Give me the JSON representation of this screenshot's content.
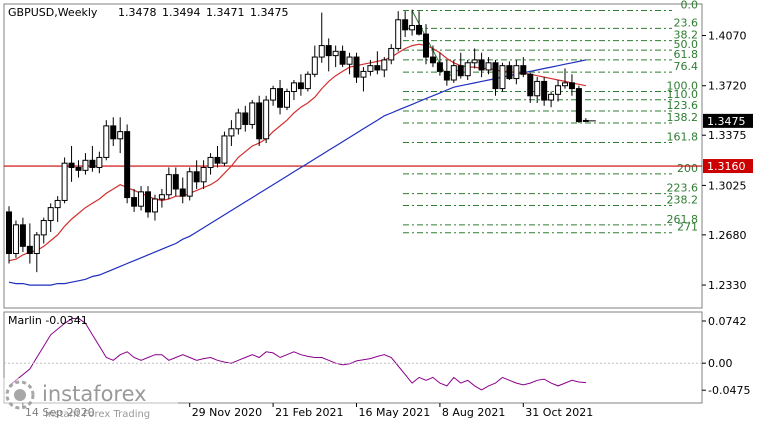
{
  "chart_data": [
    {
      "type": "candlestick",
      "symbol": "GBPUSD,Weekly",
      "ohlc_header": [
        "1.3478",
        "1.3494",
        "1.3471",
        "1.3475"
      ],
      "ylim": [
        1.217,
        1.429
      ],
      "y_ticks": [
        "1.4070",
        "1.3720",
        "1.3375",
        "1.3025",
        "1.2680",
        "1.2330"
      ],
      "current_price": {
        "label": "1.3475",
        "value": 1.3475
      },
      "horizontal_line": {
        "label": "1.3160",
        "value": 1.316,
        "color": "#cc0000"
      },
      "x_labels": [
        "14 Sep 2020",
        "29 Nov 2020",
        "21 Feb 2021",
        "16 May 2021",
        "8 Aug 2021",
        "31 Oct 2021"
      ],
      "fib_levels": [
        {
          "label": "0.0",
          "value": 1.4245
        },
        {
          "label": "23.6",
          "value": 1.412
        },
        {
          "label": "38.2",
          "value": 1.4035
        },
        {
          "label": "50.0",
          "value": 1.3968
        },
        {
          "label": "61.8",
          "value": 1.39
        },
        {
          "label": "76.4",
          "value": 1.3815
        },
        {
          "label": "100.0",
          "value": 1.368
        },
        {
          "label": "110.0",
          "value": 1.3622
        },
        {
          "label": "123.6",
          "value": 1.3544
        },
        {
          "label": "138.2",
          "value": 1.346
        },
        {
          "label": "161.8",
          "value": 1.3324
        },
        {
          "label": "200",
          "value": 1.3105
        },
        {
          "label": "223.6",
          "value": 1.2968
        },
        {
          "label": "238.2",
          "value": 1.2885
        },
        {
          "label": "261.8",
          "value": 1.275
        },
        {
          "label": "271",
          "value": 1.2695
        }
      ],
      "candles": [
        [
          1.284,
          1.288,
          1.248,
          1.255
        ],
        [
          1.255,
          1.278,
          1.252,
          1.275
        ],
        [
          1.275,
          1.28,
          1.256,
          1.26
        ],
        [
          1.26,
          1.276,
          1.248,
          1.255
        ],
        [
          1.255,
          1.27,
          1.242,
          1.268
        ],
        [
          1.268,
          1.28,
          1.262,
          1.278
        ],
        [
          1.278,
          1.29,
          1.27,
          1.287
        ],
        [
          1.287,
          1.295,
          1.277,
          1.292
        ],
        [
          1.292,
          1.322,
          1.29,
          1.318
        ],
        [
          1.318,
          1.33,
          1.305,
          1.315
        ],
        [
          1.315,
          1.32,
          1.308,
          1.313
        ],
        [
          1.313,
          1.325,
          1.31,
          1.32
        ],
        [
          1.32,
          1.33,
          1.312,
          1.315
        ],
        [
          1.315,
          1.326,
          1.311,
          1.322
        ],
        [
          1.322,
          1.348,
          1.32,
          1.344
        ],
        [
          1.344,
          1.35,
          1.33,
          1.335
        ],
        [
          1.335,
          1.35,
          1.325,
          1.34
        ],
        [
          1.34,
          1.345,
          1.29,
          1.294
        ],
        [
          1.294,
          1.3,
          1.284,
          1.288
        ],
        [
          1.288,
          1.302,
          1.285,
          1.298
        ],
        [
          1.298,
          1.302,
          1.28,
          1.284
        ],
        [
          1.284,
          1.296,
          1.278,
          1.293
        ],
        [
          1.293,
          1.3,
          1.287,
          1.296
        ],
        [
          1.296,
          1.315,
          1.293,
          1.31
        ],
        [
          1.31,
          1.315,
          1.295,
          1.3
        ],
        [
          1.3,
          1.308,
          1.29,
          1.295
        ],
        [
          1.295,
          1.315,
          1.292,
          1.312
        ],
        [
          1.312,
          1.32,
          1.3,
          1.305
        ],
        [
          1.305,
          1.32,
          1.3,
          1.315
        ],
        [
          1.315,
          1.325,
          1.31,
          1.322
        ],
        [
          1.322,
          1.33,
          1.315,
          1.318
        ],
        [
          1.318,
          1.34,
          1.316,
          1.337
        ],
        [
          1.337,
          1.348,
          1.33,
          1.342
        ],
        [
          1.342,
          1.356,
          1.338,
          1.353
        ],
        [
          1.353,
          1.358,
          1.34,
          1.345
        ],
        [
          1.345,
          1.362,
          1.342,
          1.36
        ],
        [
          1.36,
          1.365,
          1.33,
          1.335
        ],
        [
          1.335,
          1.365,
          1.332,
          1.362
        ],
        [
          1.362,
          1.372,
          1.358,
          1.37
        ],
        [
          1.37,
          1.376,
          1.352,
          1.357
        ],
        [
          1.357,
          1.37,
          1.355,
          1.368
        ],
        [
          1.368,
          1.376,
          1.362,
          1.374
        ],
        [
          1.374,
          1.38,
          1.365,
          1.37
        ],
        [
          1.37,
          1.382,
          1.368,
          1.38
        ],
        [
          1.38,
          1.4,
          1.378,
          1.392
        ],
        [
          1.392,
          1.423,
          1.388,
          1.4
        ],
        [
          1.4,
          1.405,
          1.382,
          1.393
        ],
        [
          1.393,
          1.4,
          1.385,
          1.396
        ],
        [
          1.396,
          1.4,
          1.385,
          1.387
        ],
        [
          1.387,
          1.395,
          1.38,
          1.392
        ],
        [
          1.392,
          1.395,
          1.374,
          1.378
        ],
        [
          1.378,
          1.385,
          1.368,
          1.382
        ],
        [
          1.382,
          1.39,
          1.379,
          1.386
        ],
        [
          1.386,
          1.396,
          1.38,
          1.383
        ],
        [
          1.383,
          1.392,
          1.378,
          1.39
        ],
        [
          1.39,
          1.401,
          1.387,
          1.398
        ],
        [
          1.398,
          1.424,
          1.396,
          1.418
        ],
        [
          1.418,
          1.424,
          1.406,
          1.411
        ],
        [
          1.411,
          1.425,
          1.407,
          1.414
        ],
        [
          1.414,
          1.424,
          1.407,
          1.408
        ],
        [
          1.408,
          1.415,
          1.387,
          1.392
        ],
        [
          1.392,
          1.4,
          1.385,
          1.388
        ],
        [
          1.388,
          1.395,
          1.379,
          1.382
        ],
        [
          1.382,
          1.39,
          1.372,
          1.376
        ],
        [
          1.376,
          1.39,
          1.374,
          1.386
        ],
        [
          1.386,
          1.395,
          1.377,
          1.379
        ],
        [
          1.379,
          1.39,
          1.376,
          1.388
        ],
        [
          1.388,
          1.398,
          1.384,
          1.39
        ],
        [
          1.39,
          1.395,
          1.378,
          1.383
        ],
        [
          1.383,
          1.392,
          1.38,
          1.388
        ],
        [
          1.388,
          1.39,
          1.365,
          1.37
        ],
        [
          1.37,
          1.388,
          1.368,
          1.386
        ],
        [
          1.386,
          1.389,
          1.376,
          1.377
        ],
        [
          1.377,
          1.39,
          1.373,
          1.386
        ],
        [
          1.386,
          1.392,
          1.378,
          1.38
        ],
        [
          1.38,
          1.381,
          1.36,
          1.365
        ],
        [
          1.365,
          1.378,
          1.36,
          1.375
        ],
        [
          1.375,
          1.378,
          1.358,
          1.362
        ],
        [
          1.362,
          1.368,
          1.357,
          1.366
        ],
        [
          1.366,
          1.376,
          1.361,
          1.372
        ],
        [
          1.372,
          1.384,
          1.37,
          1.374
        ],
        [
          1.374,
          1.38,
          1.365,
          1.37
        ],
        [
          1.37,
          1.372,
          1.346,
          1.347
        ],
        [
          1.3478,
          1.3494,
          1.3471,
          1.3475
        ]
      ],
      "ma_red": [
        1.25,
        1.251,
        1.254,
        1.256,
        1.257,
        1.26,
        1.264,
        1.268,
        1.274,
        1.279,
        1.283,
        1.287,
        1.29,
        1.293,
        1.297,
        1.3,
        1.303,
        1.301,
        1.299,
        1.297,
        1.295,
        1.293,
        1.292,
        1.293,
        1.295,
        1.295,
        1.297,
        1.299,
        1.301,
        1.303,
        1.306,
        1.311,
        1.316,
        1.322,
        1.326,
        1.33,
        1.332,
        1.335,
        1.34,
        1.344,
        1.348,
        1.353,
        1.357,
        1.36,
        1.364,
        1.37,
        1.375,
        1.379,
        1.382,
        1.385,
        1.386,
        1.387,
        1.388,
        1.389,
        1.39,
        1.392,
        1.395,
        1.398,
        1.4,
        1.401,
        1.4,
        1.398,
        1.395,
        1.391,
        1.388,
        1.386,
        1.385,
        1.385,
        1.384,
        1.384,
        1.383,
        1.382,
        1.382,
        1.381,
        1.381,
        1.38,
        1.379,
        1.378,
        1.377,
        1.376,
        1.375,
        1.374,
        1.373,
        1.372
      ],
      "ma_blue": [
        1.235,
        1.234,
        1.234,
        1.233,
        1.233,
        1.233,
        1.233,
        1.234,
        1.234,
        1.235,
        1.236,
        1.237,
        1.239,
        1.24,
        1.242,
        1.244,
        1.246,
        1.248,
        1.25,
        1.252,
        1.254,
        1.256,
        1.258,
        1.26,
        1.262,
        1.265,
        1.267,
        1.27,
        1.273,
        1.276,
        1.279,
        1.282,
        1.285,
        1.288,
        1.291,
        1.294,
        1.297,
        1.3,
        1.303,
        1.306,
        1.309,
        1.312,
        1.315,
        1.318,
        1.321,
        1.324,
        1.327,
        1.33,
        1.333,
        1.336,
        1.339,
        1.342,
        1.345,
        1.348,
        1.351,
        1.353,
        1.355,
        1.357,
        1.359,
        1.361,
        1.363,
        1.365,
        1.367,
        1.369,
        1.371,
        1.372,
        1.373,
        1.374,
        1.375,
        1.376,
        1.377,
        1.378,
        1.379,
        1.38,
        1.381,
        1.382,
        1.383,
        1.384,
        1.385,
        1.386,
        1.387,
        1.388,
        1.389,
        1.39
      ]
    },
    {
      "type": "line",
      "name": "Marlin",
      "header_label": "Marlin -0.0341",
      "ylim": [
        -0.07,
        0.09
      ],
      "y_ticks": [
        "0.0742",
        "0.00",
        "-0.0475"
      ],
      "color": "#8b008b",
      "values": [
        -0.04,
        -0.03,
        -0.02,
        -0.01,
        0.01,
        0.03,
        0.05,
        0.06,
        0.07,
        0.078,
        0.079,
        0.07,
        0.05,
        0.03,
        0.01,
        0.005,
        0.015,
        0.02,
        0.01,
        0.005,
        0.01,
        0.015,
        0.015,
        0.005,
        0.01,
        0.015,
        0.01,
        0.005,
        0.008,
        0.01,
        0.005,
        0.002,
        0.0,
        0.005,
        0.01,
        0.015,
        0.01,
        0.02,
        0.018,
        0.01,
        0.015,
        0.02,
        0.015,
        0.012,
        0.01,
        0.01,
        0.005,
        0.0,
        -0.003,
        -0.001,
        0.004,
        0.006,
        0.008,
        0.012,
        0.015,
        0.01,
        -0.005,
        -0.02,
        -0.035,
        -0.025,
        -0.03,
        -0.025,
        -0.035,
        -0.04,
        -0.025,
        -0.035,
        -0.03,
        -0.04,
        -0.047,
        -0.04,
        -0.035,
        -0.025,
        -0.03,
        -0.035,
        -0.038,
        -0.035,
        -0.03,
        -0.028,
        -0.035,
        -0.04,
        -0.035,
        -0.03,
        -0.033,
        -0.0341
      ]
    }
  ],
  "watermark": {
    "brand": "instaforex",
    "tagline": "Instant Forex Trading"
  }
}
